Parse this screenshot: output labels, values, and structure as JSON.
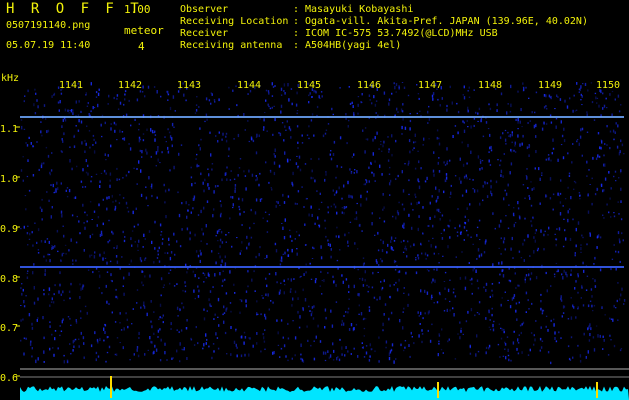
{
  "header": {
    "title": "H R O F F T",
    "version": "1.00",
    "file_name": "0507191140.png",
    "meteor_label": "meteor",
    "meteor_count": "4",
    "date_time": "05.07.19 11:40"
  },
  "info": [
    {
      "key": "Observer",
      "value": "Masayuki Kobayashi"
    },
    {
      "key": "Receiving Location",
      "value": "Ogata-vill. Akita-Pref. JAPAN (139.96E, 40.02N)"
    },
    {
      "key": "Receiver",
      "value": "ICOM IC-575 53.7492(@LCD)MHz USB"
    },
    {
      "key": "Receiving antenna",
      "value": "A504HB(yagi 4el)"
    }
  ],
  "axis": {
    "y_unit": "kHz",
    "y_ticks": [
      "1.1",
      "1.0",
      "0.9",
      "0.8",
      "0.7",
      "0.6"
    ],
    "x_ticks": [
      "1141",
      "1142",
      "1143",
      "1144",
      "1145",
      "1146",
      "1147",
      "1148",
      "1149",
      "1150"
    ]
  },
  "colors": {
    "text": "#f2f20a",
    "background": "#000000",
    "noise": "#1a2eff",
    "carrier_line": "#6fa8ff",
    "amplitude": "#00e5ff",
    "marker": "#ffdd00"
  }
}
